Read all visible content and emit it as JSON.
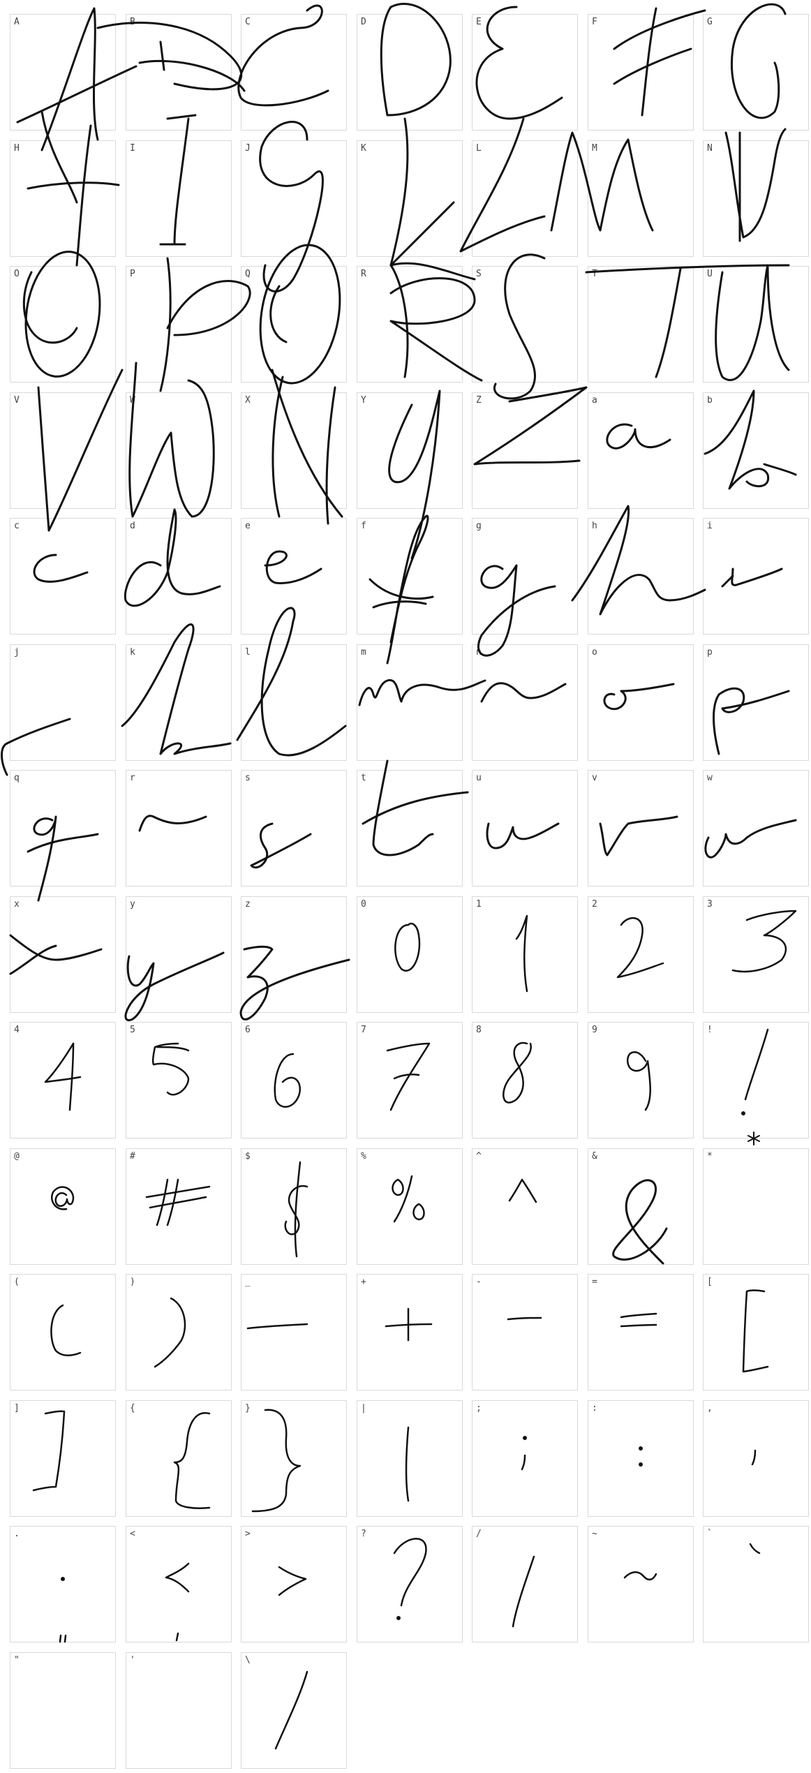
{
  "glyph_sheet": {
    "columns": 7,
    "labels": [
      "A",
      "B",
      "C",
      "D",
      "E",
      "F",
      "G",
      "H",
      "I",
      "J",
      "K",
      "L",
      "M",
      "N",
      "O",
      "P",
      "Q",
      "R",
      "S",
      "T",
      "U",
      "V",
      "W",
      "X",
      "Y",
      "Z",
      "a",
      "b",
      "c",
      "d",
      "e",
      "f",
      "g",
      "h",
      "i",
      "j",
      "k",
      "l",
      "m",
      "n",
      "o",
      "p",
      "q",
      "r",
      "s",
      "t",
      "u",
      "v",
      "w",
      "x",
      "y",
      "z",
      "0",
      "1",
      "2",
      "3",
      "4",
      "5",
      "6",
      "7",
      "8",
      "9",
      "!",
      "@",
      "#",
      "$",
      "%",
      "^",
      "&",
      "*",
      "(",
      ")",
      "_",
      "+",
      "-",
      "=",
      "[",
      "]",
      "{",
      "}",
      "|",
      ";",
      ":",
      ",",
      ".",
      "<",
      ">",
      "?",
      "/",
      "~",
      "`",
      "\"",
      "'",
      "\\"
    ]
  }
}
